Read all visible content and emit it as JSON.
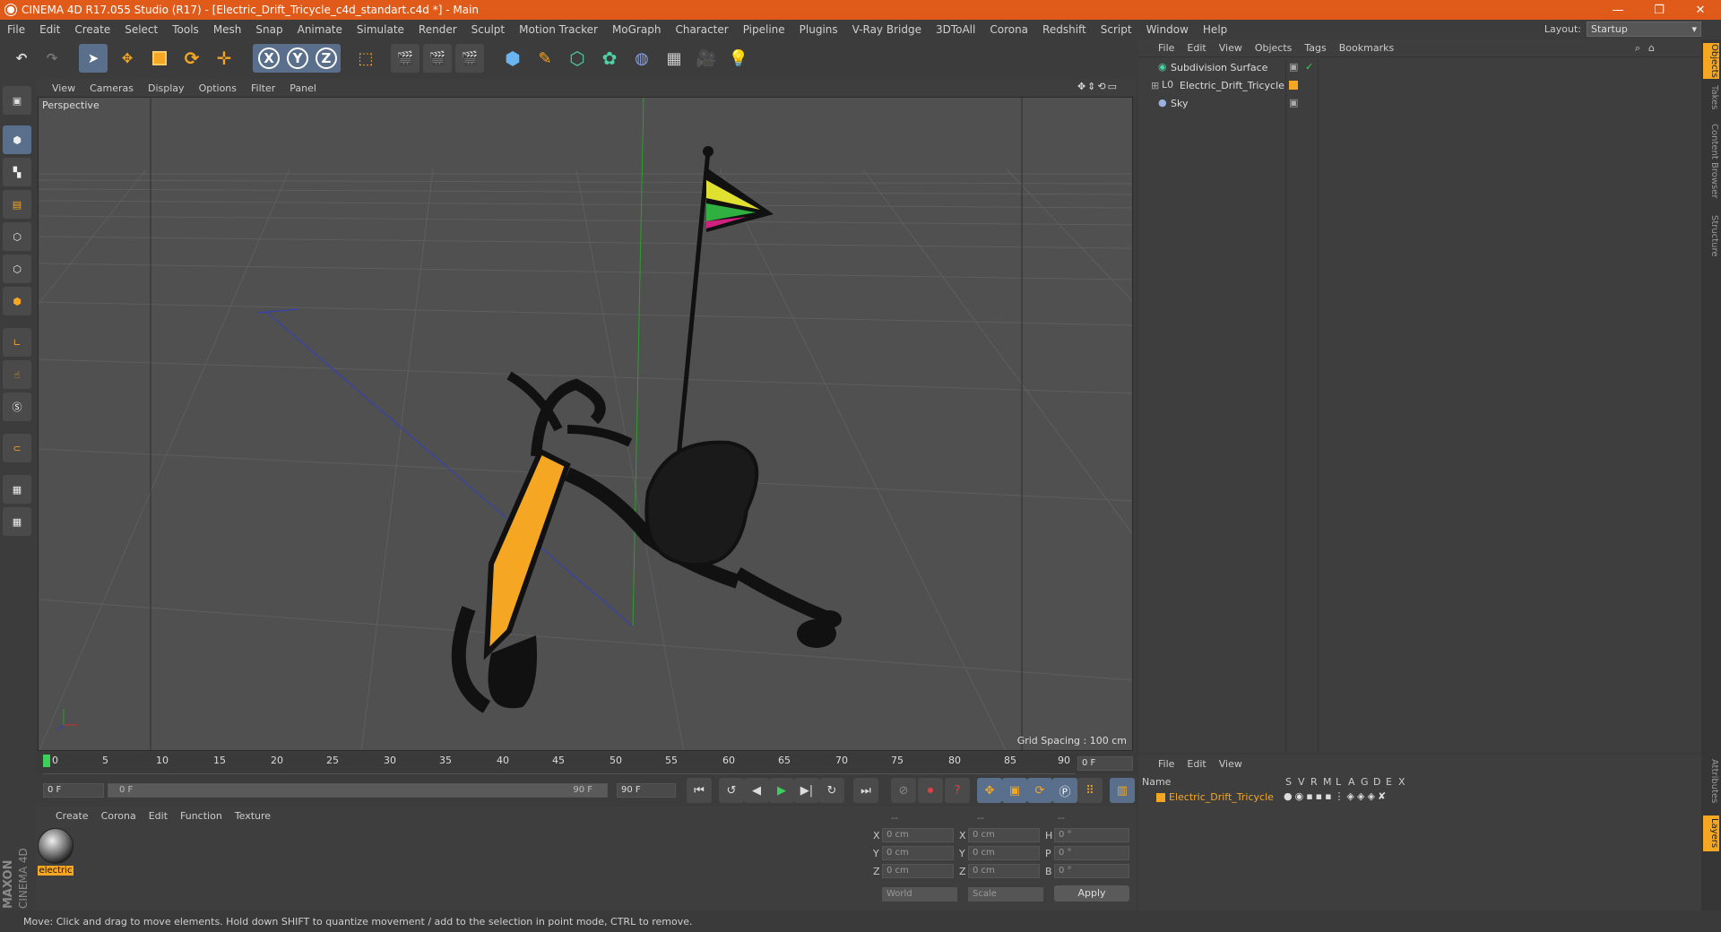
{
  "window": {
    "title": "CINEMA 4D R17.055 Studio (R17) - [Electric_Drift_Tricycle_c4d_standart.c4d *] - Main",
    "minimize": "—",
    "restore": "❐",
    "close": "✕"
  },
  "menu": [
    "File",
    "Edit",
    "Create",
    "Select",
    "Tools",
    "Mesh",
    "Snap",
    "Animate",
    "Simulate",
    "Render",
    "Sculpt",
    "Motion Tracker",
    "MoGraph",
    "Character",
    "Pipeline",
    "Plugins",
    "V-Ray Bridge",
    "3DToAll",
    "Corona",
    "Redshift",
    "Script",
    "Window",
    "Help"
  ],
  "layout": {
    "label": "Layout:",
    "value": "Startup"
  },
  "toolbar": {
    "x_label": "X",
    "y_label": "Y",
    "z_label": "Z"
  },
  "viewport": {
    "menu": [
      "View",
      "Cameras",
      "Display",
      "Options",
      "Filter",
      "Panel"
    ],
    "label": "Perspective",
    "grid_spacing": "Grid Spacing : 100 cm"
  },
  "timeline": {
    "ticks": [
      "0",
      "5",
      "10",
      "15",
      "20",
      "25",
      "30",
      "35",
      "40",
      "45",
      "50",
      "55",
      "60",
      "65",
      "70",
      "75",
      "80",
      "85",
      "90"
    ],
    "current_frame": "0 F",
    "start": "0 F",
    "range_start": "0 F",
    "range_end": "90 F",
    "end": "90 F"
  },
  "materials": {
    "menu": [
      "Create",
      "Corona",
      "Edit",
      "Function",
      "Texture"
    ],
    "items": [
      {
        "name": "electric"
      }
    ]
  },
  "coords": {
    "headers": [
      "--",
      "--",
      "--"
    ],
    "rows": [
      {
        "a": "X",
        "av": "0 cm",
        "b": "X",
        "bv": "0 cm",
        "c": "H",
        "cv": "0 °"
      },
      {
        "a": "Y",
        "av": "0 cm",
        "b": "Y",
        "bv": "0 cm",
        "c": "P",
        "cv": "0 °"
      },
      {
        "a": "Z",
        "av": "0 cm",
        "b": "Z",
        "bv": "0 cm",
        "c": "B",
        "cv": "0 °"
      }
    ],
    "world": "World",
    "scale": "Scale",
    "apply": "Apply"
  },
  "objects": {
    "menu": [
      "File",
      "Edit",
      "View",
      "Objects",
      "Tags",
      "Bookmarks"
    ],
    "items": [
      "Subdivision Surface",
      "Electric_Drift_Tricycle",
      "Sky"
    ]
  },
  "layers": {
    "menu": [
      "File",
      "Edit",
      "View"
    ],
    "name_header": "Name",
    "cols": [
      "S",
      "V",
      "R",
      "M",
      "L",
      "A",
      "G",
      "D",
      "E",
      "X"
    ],
    "item": "Electric_Drift_Tricycle"
  },
  "right_tabs": [
    "Objects",
    "Takes",
    "Content Browser",
    "Structure"
  ],
  "right_tabs_bottom": [
    "Attributes",
    "Layers"
  ],
  "brand": {
    "maxon": "MAXON",
    "product": "CINEMA 4D"
  },
  "status": "Move: Click and drag to move elements. Hold down SHIFT to quantize movement / add to the selection in point mode, CTRL to remove.",
  "colors": {
    "title_bar": "#e05a1a",
    "accent": "#596f8c",
    "orange": "#f5a623"
  }
}
